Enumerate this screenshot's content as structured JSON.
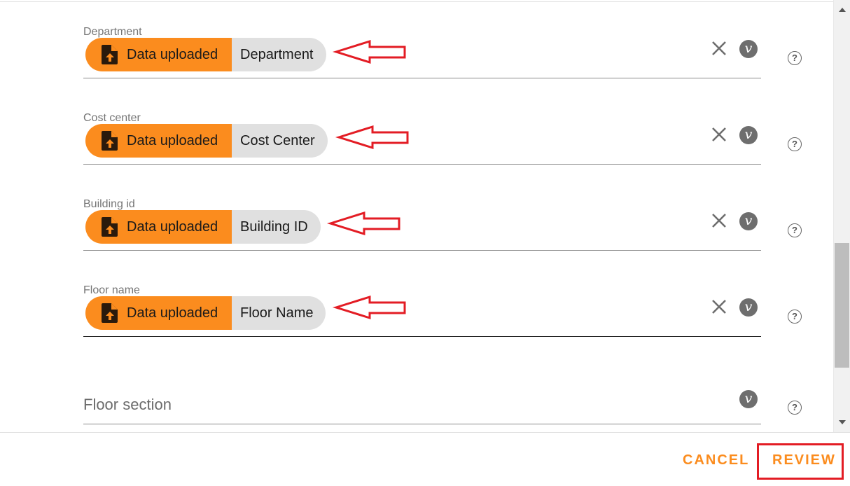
{
  "fields": [
    {
      "label": "Department",
      "source": "Data uploaded",
      "value": "Department",
      "active": false
    },
    {
      "label": "Cost center",
      "source": "Data uploaded",
      "value": "Cost Center",
      "active": false
    },
    {
      "label": "Building id",
      "source": "Data uploaded",
      "value": "Building ID",
      "active": false
    },
    {
      "label": "Floor name",
      "source": "Data uploaded",
      "value": "Floor Name",
      "active": true
    }
  ],
  "empty_field": {
    "placeholder": "Floor section"
  },
  "icons": {
    "source": "file-upload-icon",
    "clear": "close-icon",
    "variable": "variable-icon",
    "variable_glyph": "v",
    "help": "help-icon",
    "help_glyph": "?"
  },
  "footer": {
    "cancel_label": "CANCEL",
    "review_label": "REVIEW"
  },
  "colors": {
    "accent": "#fb8c1e",
    "annotation": "#e31c24",
    "chip_value_bg": "#e0e0e0"
  },
  "scroll": {
    "thumb_start_fraction": 0.56,
    "thumb_visible_fraction": 0.29
  }
}
